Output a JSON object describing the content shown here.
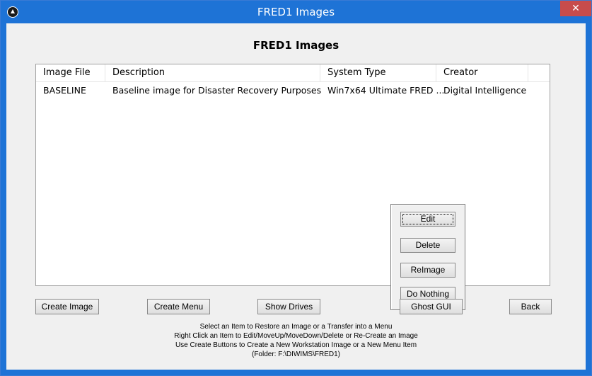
{
  "window": {
    "title": "FRED1 Images",
    "close_label": "✕"
  },
  "heading": "FRED1 Images",
  "table": {
    "columns": [
      "Image File",
      "Description",
      "System Type",
      "Creator"
    ],
    "rows": [
      [
        "BASELINE",
        "Baseline image for Disaster Recovery Purposes",
        "Win7x64 Ultimate FRED ...",
        "Digital Intelligence"
      ]
    ]
  },
  "context_menu": {
    "items": [
      "Edit",
      "Delete",
      "ReImage",
      "Do Nothing"
    ]
  },
  "buttons": {
    "create_image": "Create Image",
    "create_menu": "Create Menu",
    "show_drives": "Show Drives",
    "ghost_gui": "Ghost GUI",
    "back": "Back"
  },
  "instructions": [
    "Select an Item to Restore an Image or a Transfer into a Menu",
    "Right Click an Item to Edit/MoveUp/MoveDown/Delete or Re-Create an Image",
    "Use Create Buttons to Create a New Workstation Image or a New Menu Item",
    "(Folder: F:\\DIWIMS\\FRED1)"
  ],
  "colors": {
    "titlebar": "#1e73d6",
    "close": "#c74c4c",
    "client": "#f0f0f0"
  }
}
